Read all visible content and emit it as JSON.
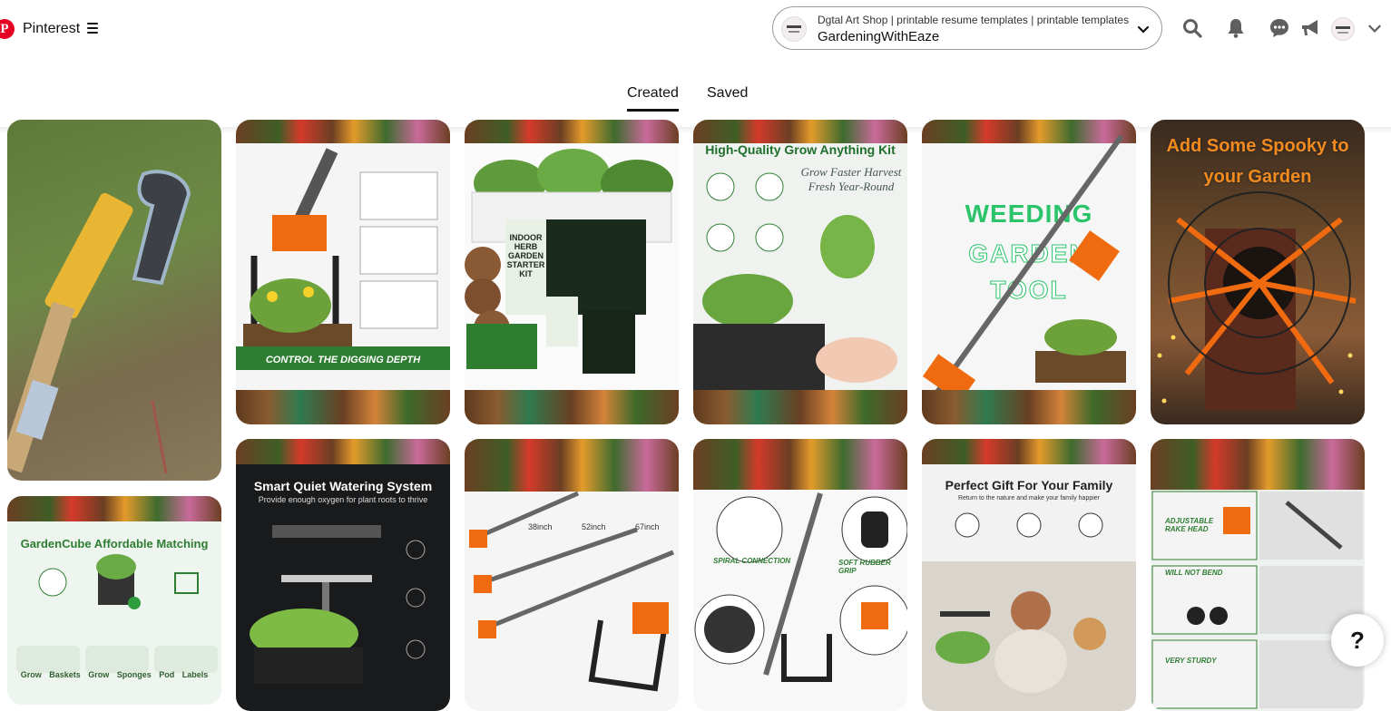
{
  "header": {
    "brand": "Pinterest",
    "account_switcher": {
      "line1": "Dgtal Art Shop | printable resume templates | printable templates",
      "line2": "GardeningWithEaze"
    }
  },
  "tabs": [
    {
      "label": "Created",
      "active": true
    },
    {
      "label": "Saved",
      "active": false
    }
  ],
  "pins": [
    {
      "text": ""
    },
    {
      "text": "CONTROL THE DIGGING DEPTH"
    },
    {
      "text": "INDOOR HERB GARDEN STARTER KIT"
    },
    {
      "text": "High-Quality Grow Anything Kit",
      "sub": "Grow Faster Harvest Fresh Year-Round"
    },
    {
      "text": "WEEDING",
      "sub": "GARDEN",
      "sub2": "TOOL"
    },
    {
      "text": "Add Some Spooky to your Garden"
    },
    {
      "text": "GardenCube Affordable Matching",
      "sub": "Grow Baskets   Grow Sponges   Pod Labels"
    },
    {
      "text": "Smart Quiet Watering System",
      "sub": "Provide enough oxygen for plant roots to thrive"
    },
    {
      "text": "38inch  52inch  67inch"
    },
    {
      "text": "SPIRAL CONNECTION",
      "sub": "SOFT RUBBER GRIP"
    },
    {
      "text": "Perfect Gift For Your Family",
      "sub": "Return to the nature and make your family happier"
    },
    {
      "text": "ADJUSTABLE RAKE HEAD",
      "sub": "WILL NOT BEND",
      "sub2": "VERY STURDY"
    }
  ],
  "help_label": "?",
  "colors": {
    "pinterest_red": "#e60023",
    "orange": "#f06a10",
    "green": "#2e7d32"
  }
}
